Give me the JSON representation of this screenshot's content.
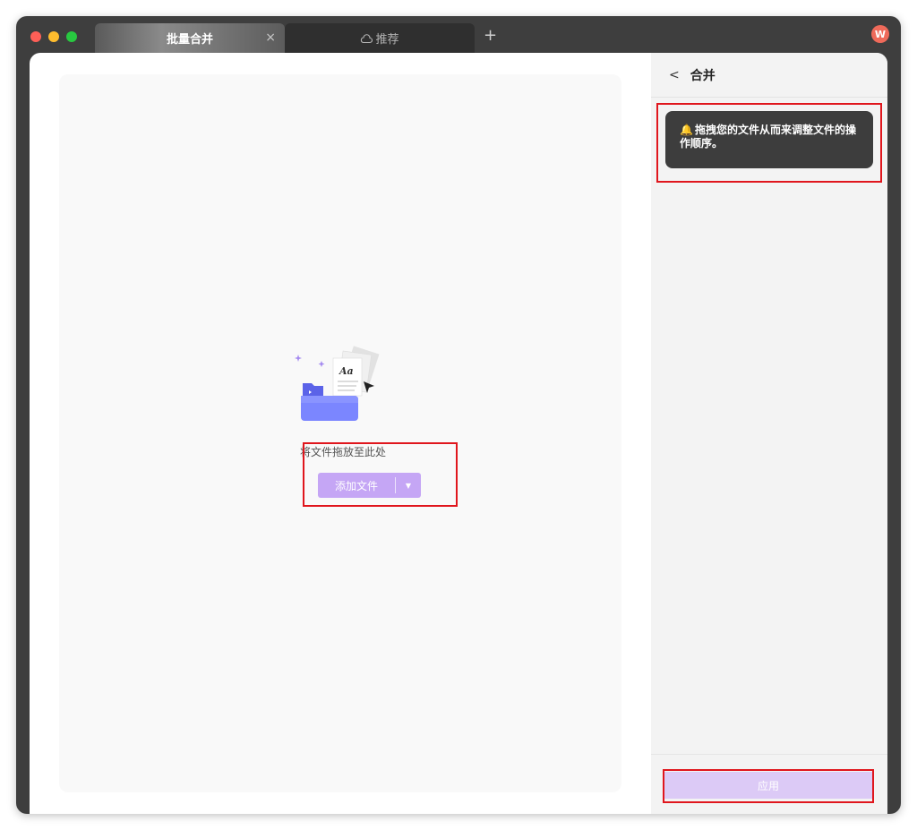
{
  "window": {
    "tabs": [
      {
        "label": "批量合并",
        "close": "×"
      },
      {
        "label": "推荐"
      }
    ],
    "new_tab": "+",
    "avatar": "W"
  },
  "workspace": {
    "drop_text": "将文件拖放至此处",
    "add_files_label": "添加文件",
    "dropdown_caret": "▼"
  },
  "sidebar": {
    "back": "<",
    "title": "合并",
    "tip": "拖拽您的文件从而来调整文件的操作顺序。",
    "apply_label": "应用"
  },
  "colors": {
    "accent": "#c5a6f5",
    "apply_disabled": "#dccaf6",
    "highlight": "#e0161d",
    "avatar": "#ef6a5a"
  }
}
